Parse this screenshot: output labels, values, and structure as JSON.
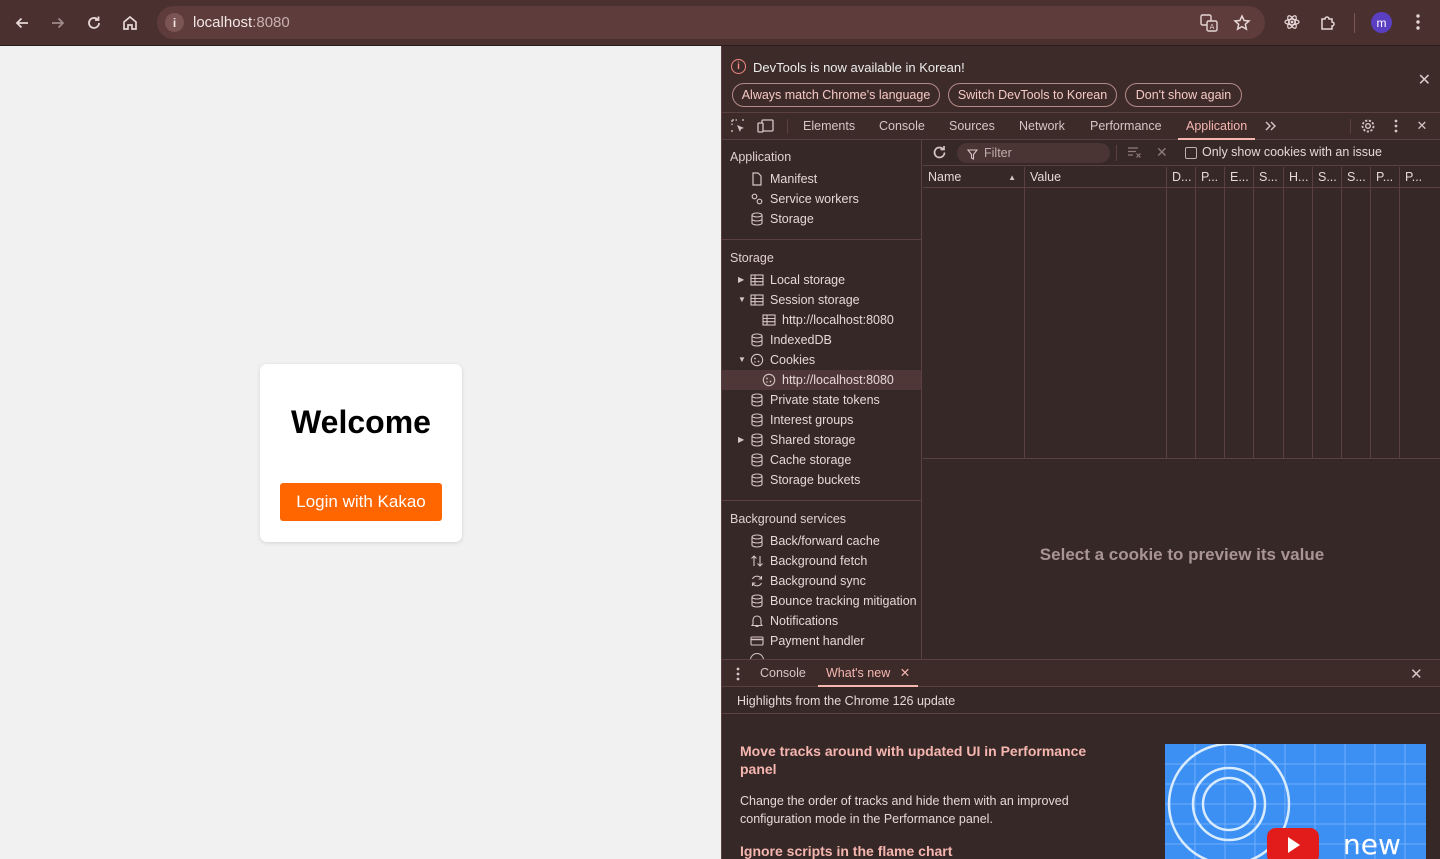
{
  "browser": {
    "url_host": "localhost",
    "url_port": ":8080",
    "avatar_letter": "m"
  },
  "page": {
    "heading": "Welcome",
    "login_button": "Login with Kakao",
    "login_button_color": "#ff6600"
  },
  "devtools": {
    "infobar": {
      "message": "DevTools is now available in Korean!",
      "buttons": [
        "Always match Chrome's language",
        "Switch DevTools to Korean",
        "Don't show again"
      ]
    },
    "tabs": [
      "Elements",
      "Console",
      "Sources",
      "Network",
      "Performance",
      "Application"
    ],
    "active_tab": "Application",
    "sidebar": {
      "application_title": "Application",
      "application_items": [
        "Manifest",
        "Service workers",
        "Storage"
      ],
      "storage_title": "Storage",
      "storage_items": {
        "local_storage": "Local storage",
        "session_storage": "Session storage",
        "session_origin": "http://localhost:8080",
        "indexeddb": "IndexedDB",
        "cookies": "Cookies",
        "cookies_origin": "http://localhost:8080",
        "private_state_tokens": "Private state tokens",
        "interest_groups": "Interest groups",
        "shared_storage": "Shared storage",
        "cache_storage": "Cache storage",
        "storage_buckets": "Storage buckets"
      },
      "background_title": "Background services",
      "background_items": [
        "Back/forward cache",
        "Background fetch",
        "Background sync",
        "Bounce tracking mitigation",
        "Notifications",
        "Payment handler"
      ]
    },
    "cookies_pane": {
      "filter_placeholder": "Filter",
      "only_issue_label": "Only show cookies with an issue",
      "columns": [
        "Name",
        "Value",
        "D...",
        "P...",
        "E...",
        "S...",
        "H...",
        "S...",
        "S...",
        "P...",
        "P..."
      ],
      "empty_message": "Select a cookie to preview its value"
    },
    "drawer": {
      "tabs": [
        "Console",
        "What's new"
      ],
      "active_tab": "What's new",
      "highlights": "Highlights from the Chrome 126 update",
      "item1_title": "Move tracks around with updated UI in Performance panel",
      "item1_body": "Change the order of tracks and hide them with an improved configuration mode in the Performance panel.",
      "item2_title": "Ignore scripts in the flame chart",
      "image_word": "new"
    },
    "accent_color": "#f6b6b0"
  }
}
